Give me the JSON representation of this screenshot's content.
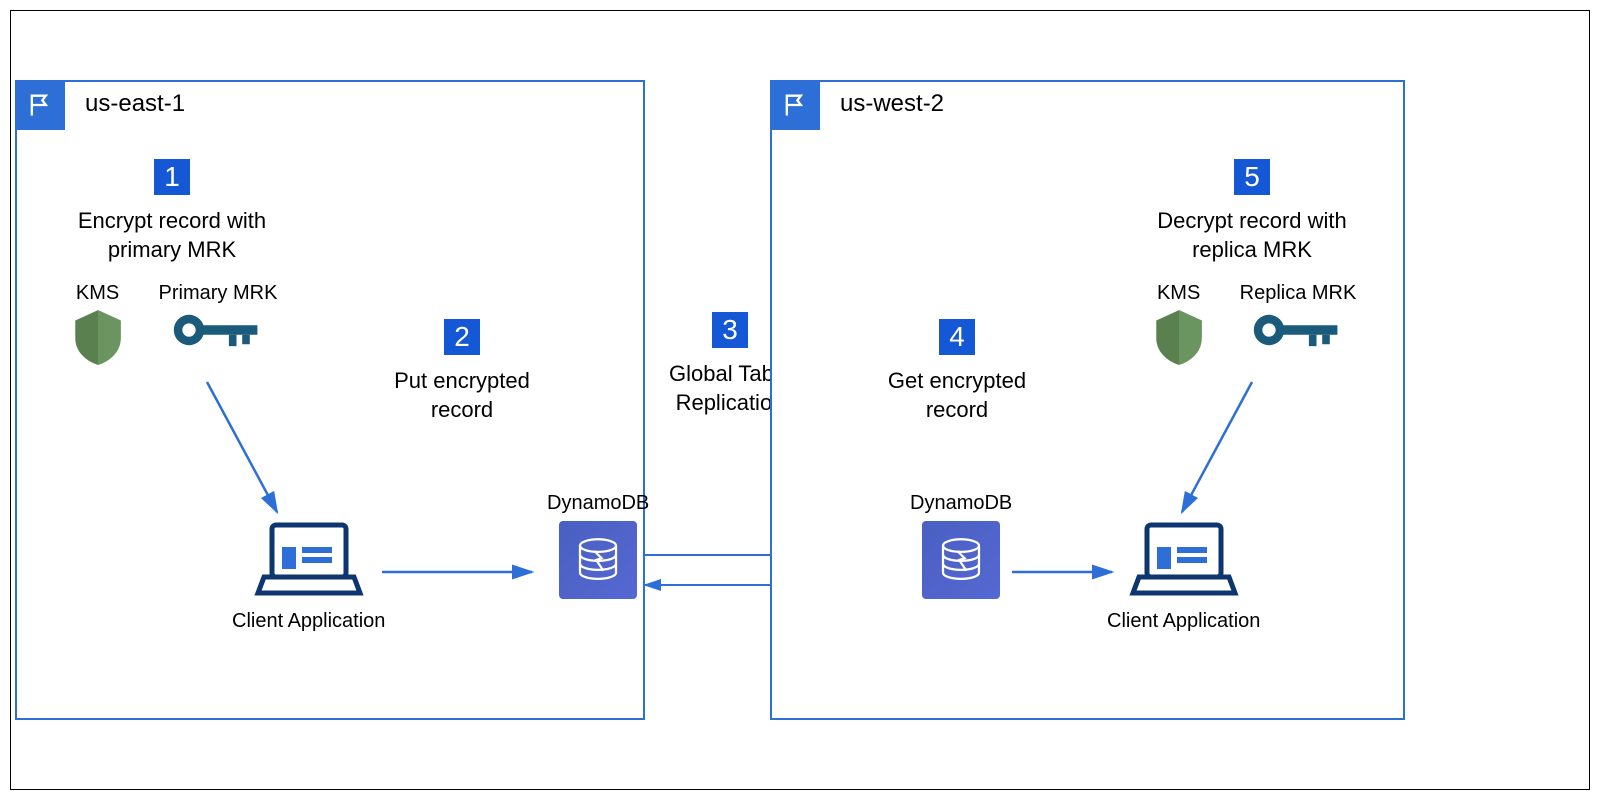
{
  "regions": {
    "left": {
      "name": "us-east-1"
    },
    "right": {
      "name": "us-west-2"
    }
  },
  "steps": {
    "s1": {
      "num": "1",
      "text": "Encrypt record with\nprimary MRK"
    },
    "s2": {
      "num": "2",
      "text": "Put encrypted\nrecord"
    },
    "s3": {
      "num": "3",
      "text": "Global Table\nReplication"
    },
    "s4": {
      "num": "4",
      "text": "Get encrypted\nrecord"
    },
    "s5": {
      "num": "5",
      "text": "Decrypt record with\nreplica MRK"
    }
  },
  "labels": {
    "kms": "KMS",
    "primary_mrk": "Primary MRK",
    "replica_mrk": "Replica MRK",
    "dynamodb": "DynamoDB",
    "client_app": "Client Application"
  }
}
